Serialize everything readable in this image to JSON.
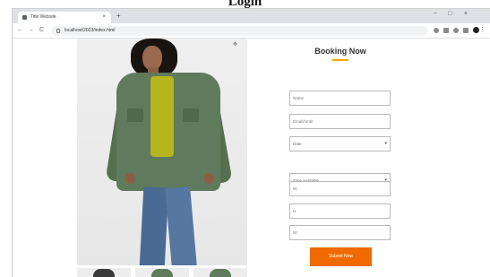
{
  "page_heading": "Login",
  "browser": {
    "tab": {
      "title": "Title Website",
      "close": "×"
    },
    "newtab": "+",
    "window_controls": [
      "−",
      "□",
      "×"
    ],
    "nav": {
      "back": "←",
      "forward": "→",
      "reload": "C"
    },
    "address": "localhost/2023/index.html",
    "menu": "⋮"
  },
  "booking": {
    "title": "Booking Now",
    "fields": [
      {
        "kind": "input",
        "placeholder": "Name"
      },
      {
        "kind": "input",
        "placeholder": "Email/nmbr"
      },
      {
        "kind": "select",
        "value": "Date"
      },
      {
        "kind": "select",
        "value": "Time available"
      },
      {
        "kind": "input",
        "placeholder": "W:"
      },
      {
        "kind": "input",
        "placeholder": "H:"
      },
      {
        "kind": "input",
        "placeholder": "W:"
      }
    ],
    "submit_label": "Submit Now"
  },
  "product": {
    "zoom_icon": "✥"
  },
  "colors": {
    "accent": "#f06a00",
    "underline": "#f0a500",
    "jacket": "#5f7a5c"
  }
}
